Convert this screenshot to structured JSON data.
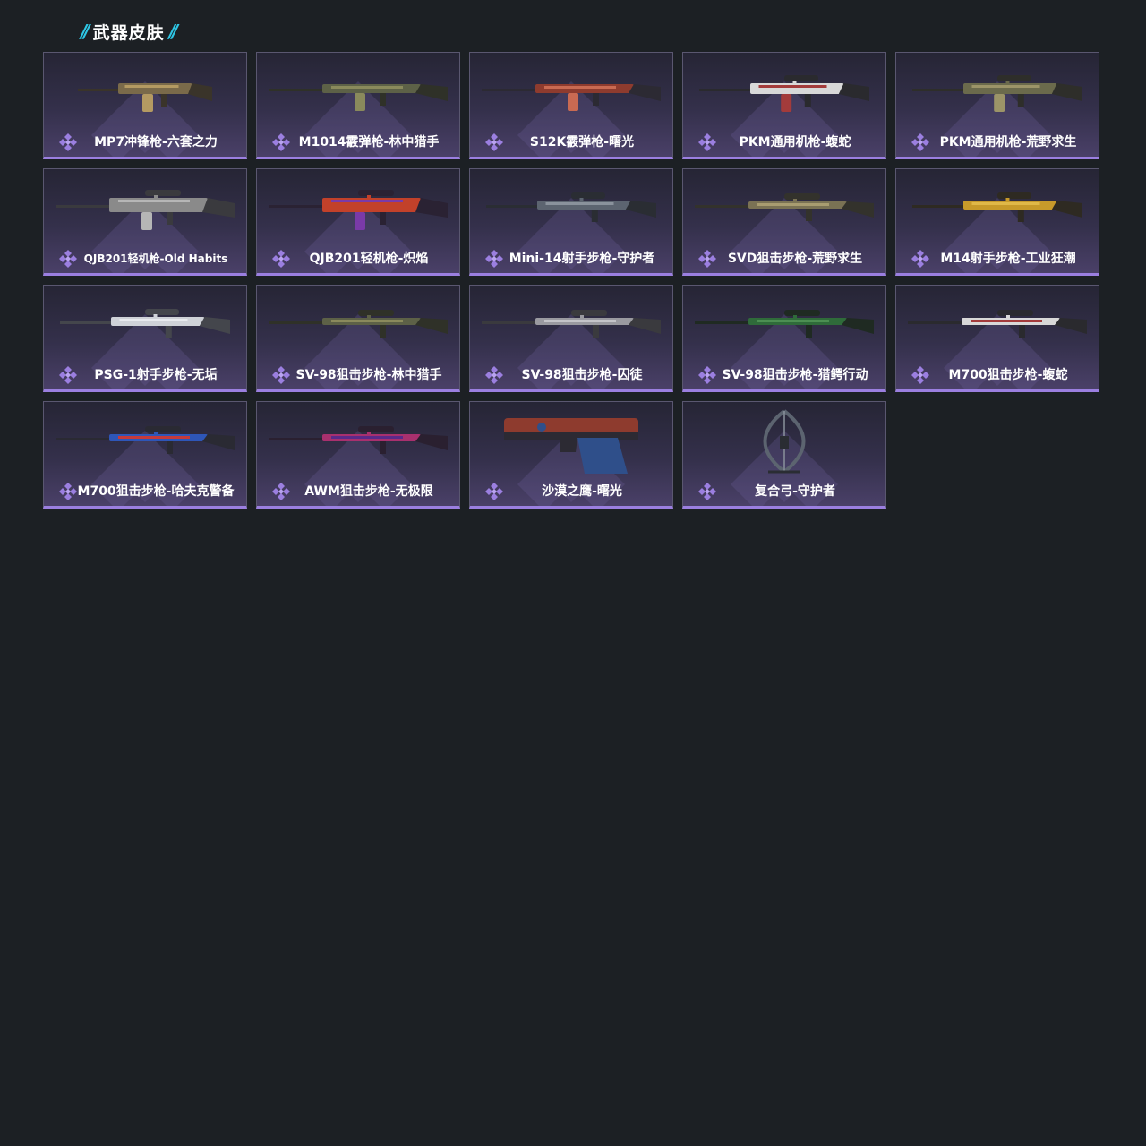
{
  "section": {
    "title": "武器皮肤",
    "accent_color": "#2ec7e6"
  },
  "colors": {
    "card_border": "#5a5770",
    "quality_purple": "#9b7fe0",
    "page_background": "#1c2024"
  },
  "skins": [
    {
      "name": "MP7冲锋枪-六套之力",
      "icon": "smg-icon",
      "palette": [
        "#7a6a4a",
        "#b49a62",
        "#3a342a"
      ]
    },
    {
      "name": "M1014霰弹枪-林中猎手",
      "icon": "shotgun-icon",
      "palette": [
        "#5d6147",
        "#8a8a5c",
        "#2f3128"
      ]
    },
    {
      "name": "S12K霰弹枪-曙光",
      "icon": "shotgun-icon",
      "palette": [
        "#8e3b2e",
        "#c96a52",
        "#2c2a33"
      ]
    },
    {
      "name": "PKM通用机枪-蝮蛇",
      "icon": "machine-gun-icon",
      "palette": [
        "#d8d8d8",
        "#a33b3b",
        "#2a2a2e"
      ]
    },
    {
      "name": "PKM通用机枪-荒野求生",
      "icon": "machine-gun-icon",
      "palette": [
        "#6b6a4c",
        "#9c9468",
        "#2e2e2a"
      ]
    },
    {
      "name": "QJB201轻机枪-Old Habits",
      "icon": "light-machine-gun-icon",
      "palette": [
        "#8a8a8a",
        "#b6b6b6",
        "#3a3a3e"
      ]
    },
    {
      "name": "QJB201轻机枪-炽焰",
      "icon": "light-machine-gun-icon",
      "palette": [
        "#c2412a",
        "#7a3aa8",
        "#2a2233"
      ]
    },
    {
      "name": "Mini-14射手步枪-守护者",
      "icon": "rifle-icon",
      "palette": [
        "#5c6470",
        "#8a929c",
        "#2a2d33"
      ]
    },
    {
      "name": "SVD狙击步枪-荒野求生",
      "icon": "sniper-rifle-icon",
      "palette": [
        "#7a7254",
        "#a89c70",
        "#33322c"
      ]
    },
    {
      "name": "M14射手步枪-工业狂潮",
      "icon": "rifle-icon",
      "palette": [
        "#c79a2a",
        "#e0b848",
        "#2e2a22"
      ]
    },
    {
      "name": "PSG-1射手步枪-无垢",
      "icon": "rifle-icon",
      "palette": [
        "#cfd2d8",
        "#e8eaee",
        "#44464c"
      ]
    },
    {
      "name": "SV-98狙击步枪-林中猎手",
      "icon": "sniper-rifle-icon",
      "palette": [
        "#5d6147",
        "#8a8a5c",
        "#2f3128"
      ]
    },
    {
      "name": "SV-98狙击步枪-囚徒",
      "icon": "sniper-rifle-icon",
      "palette": [
        "#9a9aa0",
        "#c4c4c8",
        "#3a3a3e"
      ]
    },
    {
      "name": "SV-98狙击步枪-猎鳄行动",
      "icon": "sniper-rifle-icon",
      "palette": [
        "#2f6b3a",
        "#4c8f52",
        "#1f2a22"
      ]
    },
    {
      "name": "M700狙击步枪-蝮蛇",
      "icon": "sniper-rifle-icon",
      "palette": [
        "#d8d8d8",
        "#a33b3b",
        "#2a2a2e"
      ]
    },
    {
      "name": "M700狙击步枪-哈夫克警备",
      "icon": "sniper-rifle-icon",
      "palette": [
        "#2e56b8",
        "#c73a3a",
        "#2a2a33"
      ]
    },
    {
      "name": "AWM狙击步枪-无极限",
      "icon": "sniper-rifle-icon",
      "palette": [
        "#a8306e",
        "#5a2a8a",
        "#2a2030"
      ]
    },
    {
      "name": "沙漠之鹰-曙光",
      "icon": "pistol-icon",
      "palette": [
        "#8e3b2e",
        "#2f4f8a",
        "#2c2a33"
      ]
    },
    {
      "name": "复合弓-守护者",
      "icon": "bow-icon",
      "palette": [
        "#5c6470",
        "#8a929c",
        "#2a2d33"
      ]
    }
  ]
}
